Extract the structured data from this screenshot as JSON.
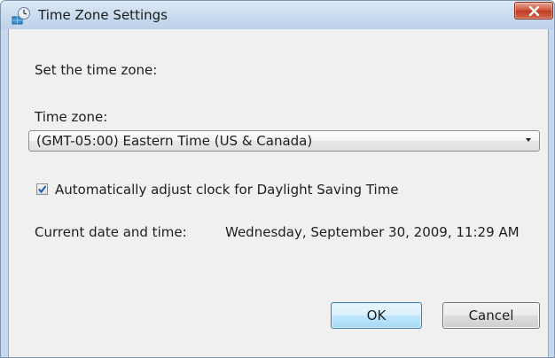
{
  "window": {
    "title": "Time Zone Settings",
    "title_icon": "clock-globe-icon",
    "close_icon": "close-icon"
  },
  "dialog": {
    "intro_label": "Set the time zone:",
    "timezone_label": "Time zone:",
    "timezone_selected": "(GMT-05:00) Eastern Time (US & Canada)",
    "dst_checkbox_label": "Automatically adjust clock for Daylight Saving Time",
    "dst_checked": true,
    "current_label": "Current date and time:",
    "current_value": "Wednesday, September 30, 2009, 11:29 AM"
  },
  "buttons": {
    "ok_label": "OK",
    "cancel_label": "Cancel"
  },
  "colors": {
    "title_bar": "#c9dbef",
    "client_bg": "#f0f0f0",
    "close_button": "#c94a32",
    "ok_button_border": "#3c7fb1"
  }
}
